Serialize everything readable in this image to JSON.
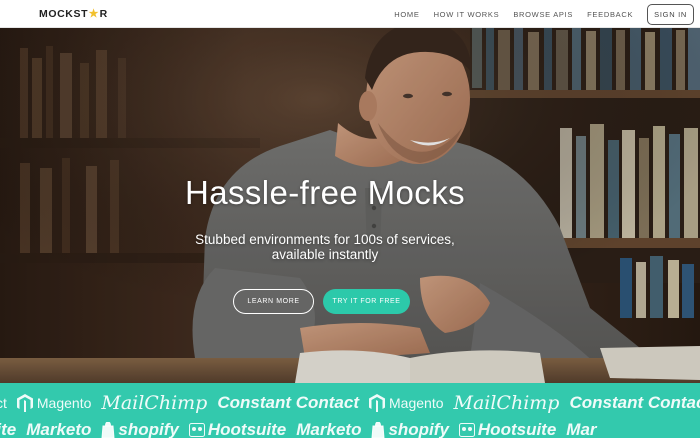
{
  "nav": {
    "logo_left": "MOCKST",
    "logo_right": "R",
    "links": [
      "HOME",
      "HOW IT WORKS",
      "BROWSE APIS",
      "FEEDBACK"
    ],
    "signin": "SIGN IN",
    "star_color": "#f2c12e"
  },
  "hero": {
    "title": "Hassle-free Mocks",
    "subtitle_line1": "Stubbed environments for 100s of services,",
    "subtitle_line2": "available instantly",
    "learn_more": "LEARN MORE",
    "try_free": "TRY IT FOR FREE",
    "accent": "#2cc9aa"
  },
  "strip": {
    "background": "#33c9ad",
    "row1": [
      "ct",
      "Magento",
      "MailChimp",
      "Constant Contact",
      "Magento",
      "MailChimp",
      "Constant Contact"
    ],
    "row2": [
      "uite",
      "Marketo",
      "shopify",
      "Hootsuite",
      "Marketo",
      "shopify",
      "Hootsuite",
      "Mar"
    ]
  }
}
